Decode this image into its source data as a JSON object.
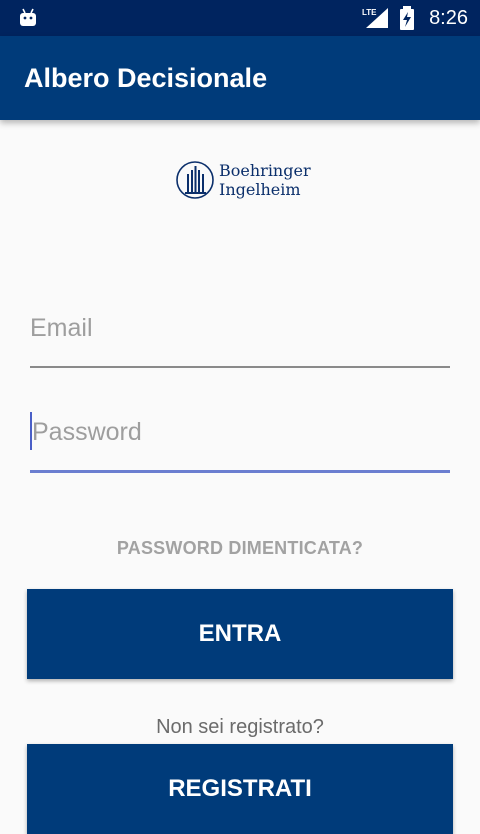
{
  "status_bar": {
    "time": "8:26",
    "network": "LTE",
    "icons": [
      "android-icon",
      "lte-signal-icon",
      "battery-charging-icon"
    ]
  },
  "app_bar": {
    "title": "Albero Decisionale",
    "color": "#003b7a"
  },
  "logo": {
    "line1": "Boehringer",
    "line2": "Ingelheim"
  },
  "form": {
    "email_placeholder": "Email",
    "email_value": "",
    "password_placeholder": "Password",
    "password_value": "",
    "forgot_label": "PASSWORD DIMENTICATA?",
    "login_label": "ENTRA",
    "not_registered_text": "Non sei registrato?",
    "register_label": "REGISTRATI"
  },
  "colors": {
    "status_bar": "#00245f",
    "primary": "#003b7a",
    "focus_accent": "#6b7ed0"
  }
}
